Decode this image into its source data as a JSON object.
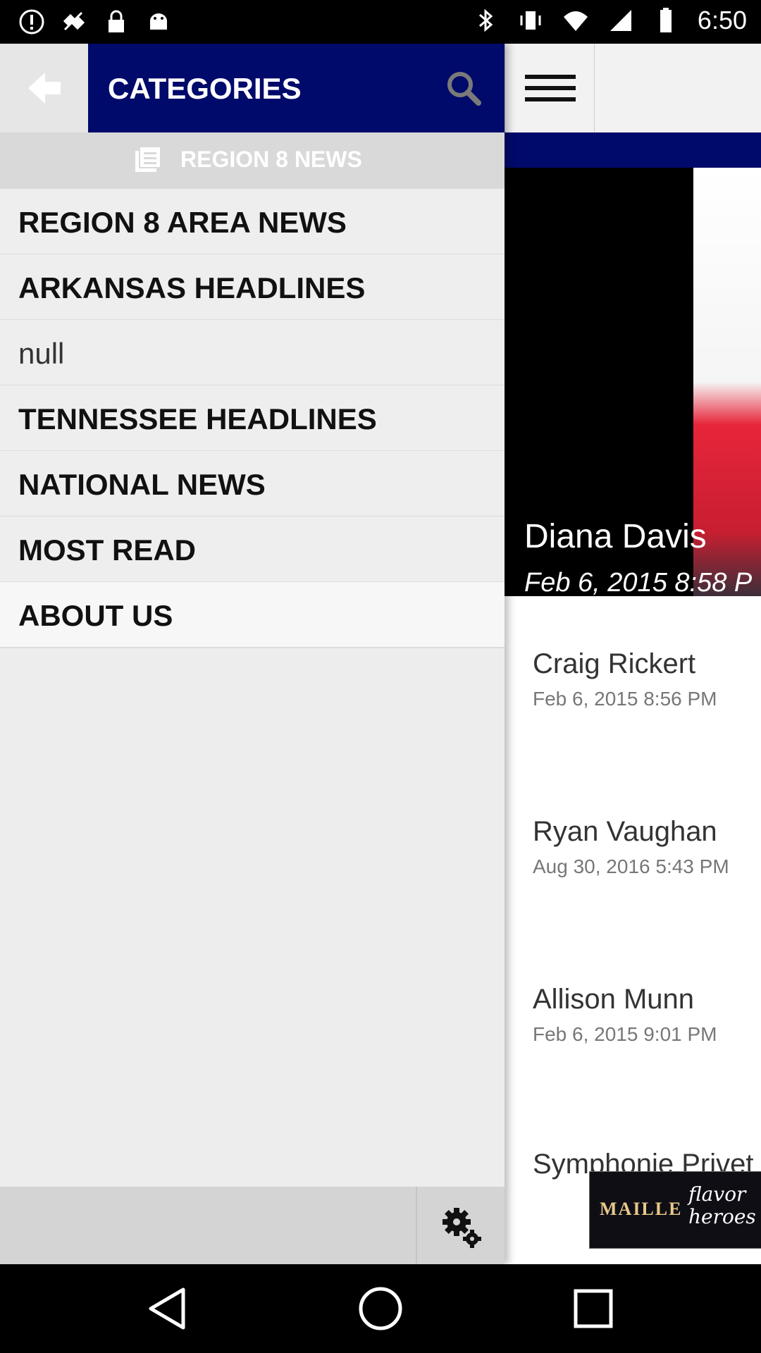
{
  "status_bar": {
    "time": "6:50",
    "left_icons": [
      "alert-circle-icon",
      "fake-gps-icon",
      "lock-icon",
      "android-icon"
    ],
    "right_icons": [
      "bluetooth-icon",
      "vibrate-icon",
      "wifi-icon",
      "signal-icon",
      "battery-icon"
    ]
  },
  "drawer": {
    "title": "CATEGORIES",
    "section_title": "REGION 8 NEWS",
    "items": [
      {
        "label": "REGION 8 AREA NEWS"
      },
      {
        "label": "ARKANSAS HEADLINES"
      },
      {
        "label": "null"
      },
      {
        "label": "TENNESSEE HEADLINES"
      },
      {
        "label": "NATIONAL NEWS"
      },
      {
        "label": "MOST READ"
      },
      {
        "label": "ABOUT US"
      }
    ]
  },
  "feed": {
    "hero": {
      "name": "Diana Davis",
      "date": "Feb 6, 2015 8:58 P"
    },
    "stories": [
      {
        "name": "Craig Rickert",
        "date": "Feb 6, 2015 8:56 PM"
      },
      {
        "name": "Ryan Vaughan",
        "date": "Aug 30, 2016 5:43 PM"
      },
      {
        "name": "Allison Munn",
        "date": "Feb 6, 2015 9:01 PM"
      },
      {
        "name": "Symphonie Privet",
        "date": ""
      }
    ],
    "ad": {
      "brand": "MAILLE",
      "tagline": "flavor heroes"
    }
  },
  "colors": {
    "brand_blue": "#000a6b",
    "drawer_bg": "#ededed"
  }
}
